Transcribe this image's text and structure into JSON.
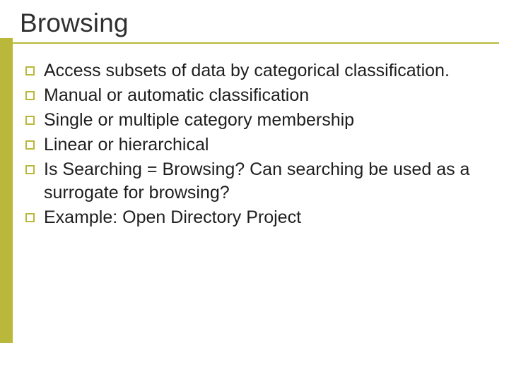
{
  "title": "Browsing",
  "bullets": [
    "Access subsets of data by categorical classification.",
    "Manual or automatic classification",
    "Single or multiple category membership",
    "Linear or hierarchical",
    "Is Searching = Browsing? Can searching be used as a surrogate for browsing?",
    "Example: Open Directory Project"
  ]
}
